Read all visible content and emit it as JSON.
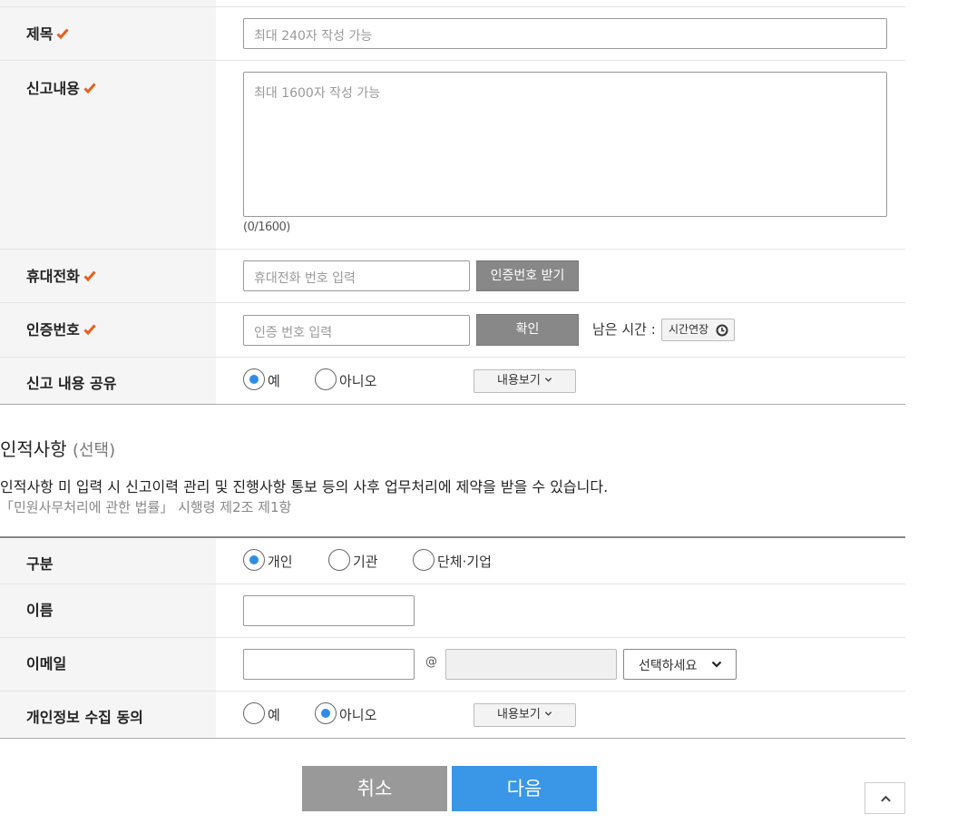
{
  "report": {
    "title_label": "제목",
    "title_placeholder": "최대 240자 작성 가능",
    "content_label": "신고내용",
    "content_placeholder": "최대 1600자 작성 가능",
    "content_counter": "(0/1600)",
    "phone_label": "휴대전화",
    "phone_placeholder": "휴대전화 번호 입력",
    "get_code_button": "인증번호 받기",
    "code_label": "인증번호",
    "code_placeholder": "인증 번호 입력",
    "confirm_button": "확인",
    "remaining_time_label": "남은 시간 :",
    "extend_time_button": "시간연장",
    "share_label": "신고 내용 공유",
    "share_yes": "예",
    "share_no": "아니오",
    "share_selected": "예",
    "view_content_button": "내용보기"
  },
  "personal": {
    "section_title": "인적사항",
    "section_optional": "(선택)",
    "notice": "인적사항 미 입력 시 신고이력 관리 및 진행사항 통보 등의 사후 업무처리에 제약을 받을 수 있습니다.",
    "law_reference": "「민원사무처리에 관한 법률」 시행령 제2조 제1항",
    "type_label": "구분",
    "type_options": [
      "개인",
      "기관",
      "단체·기업"
    ],
    "type_selected": "개인",
    "name_label": "이름",
    "email_label": "이메일",
    "email_at": "@",
    "email_domain_select": "선택하세요",
    "consent_label": "개인정보 수집 동의",
    "consent_yes": "예",
    "consent_no": "아니오",
    "consent_selected": "아니오",
    "view_content_button": "내용보기"
  },
  "actions": {
    "cancel_button": "취소",
    "next_button": "다음"
  },
  "colors": {
    "required_check": "#e8601c",
    "radio_selected": "#2f8ce6",
    "next_button": "#3a96e6",
    "cancel_button": "#999999"
  }
}
